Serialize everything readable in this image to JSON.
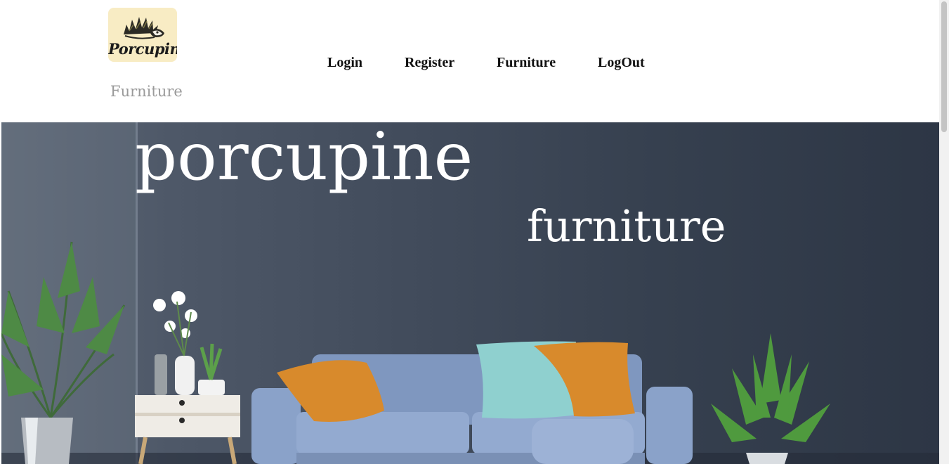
{
  "brand": {
    "logo_text": "Porcupine",
    "subtitle": "Furniture",
    "logo_icon": "porcupine-icon"
  },
  "nav": {
    "items": [
      {
        "label": "Login"
      },
      {
        "label": "Register"
      },
      {
        "label": "Furniture"
      },
      {
        "label": "LogOut"
      }
    ]
  },
  "hero": {
    "title": "porcupine",
    "subtitle": "furniture"
  },
  "colors": {
    "logo_bg": "#f8ecc4",
    "hero_bg": "#36404f",
    "sofa": "#8fa6cc",
    "pillow_orange": "#d88a2c",
    "pillow_teal": "#8fd0cf",
    "brand_sub": "#9a9a9a"
  }
}
